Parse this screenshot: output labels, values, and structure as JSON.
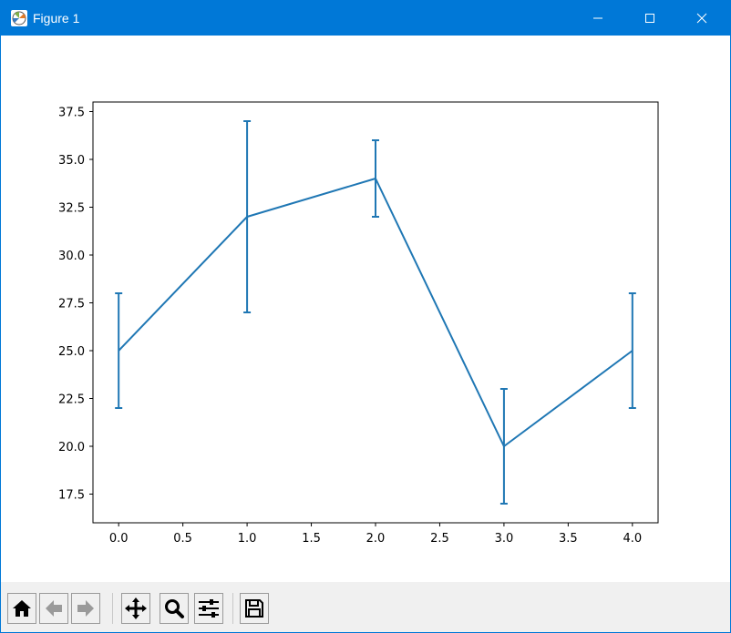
{
  "window": {
    "title": "Figure 1",
    "accent_color": "#0078d7"
  },
  "toolbar": {
    "buttons": [
      {
        "name": "home-button",
        "icon": "home-icon"
      },
      {
        "name": "back-button",
        "icon": "arrow-left-icon"
      },
      {
        "name": "forward-button",
        "icon": "arrow-right-icon"
      },
      {
        "name": "pan-button",
        "icon": "move-icon"
      },
      {
        "name": "zoom-button",
        "icon": "magnifier-icon"
      },
      {
        "name": "configure-subplots-button",
        "icon": "sliders-icon"
      },
      {
        "name": "save-button",
        "icon": "floppy-disk-icon"
      }
    ]
  },
  "chart_data": {
    "type": "line",
    "title": "",
    "xlabel": "",
    "ylabel": "",
    "xlim": [
      -0.2,
      4.2
    ],
    "ylim": [
      16,
      38
    ],
    "x_ticks": [
      "0.0",
      "0.5",
      "1.0",
      "1.5",
      "2.0",
      "2.5",
      "3.0",
      "3.5",
      "4.0"
    ],
    "y_ticks": [
      "17.5",
      "20.0",
      "22.5",
      "25.0",
      "27.5",
      "30.0",
      "32.5",
      "35.0",
      "37.5"
    ],
    "grid": false,
    "series": [
      {
        "color": "#1f77b4",
        "x": [
          0,
          1,
          2,
          3,
          4
        ],
        "y": [
          25,
          32,
          34,
          20,
          25
        ],
        "yerr": [
          3,
          5,
          2,
          3,
          3
        ]
      }
    ]
  }
}
